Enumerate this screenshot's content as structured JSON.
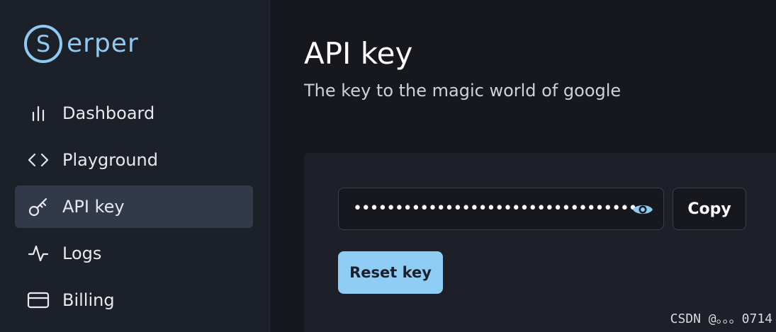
{
  "brand": {
    "logo_letter": "S",
    "logo_text": "erper",
    "color": "#8fcaf3"
  },
  "sidebar": {
    "items": [
      {
        "label": "Dashboard",
        "icon": "bar-chart-icon",
        "active": false
      },
      {
        "label": "Playground",
        "icon": "code-icon",
        "active": false
      },
      {
        "label": "API key",
        "icon": "key-icon",
        "active": true
      },
      {
        "label": "Logs",
        "icon": "activity-icon",
        "active": false
      },
      {
        "label": "Billing",
        "icon": "credit-card-icon",
        "active": false
      }
    ]
  },
  "main": {
    "title": "API key",
    "subtitle": "The key to the magic world of google",
    "key_field": {
      "masked_value": "••••••••••••••••••••••••••••••••••",
      "reveal_icon": "eye-icon"
    },
    "copy_label": "Copy",
    "reset_label": "Reset key"
  },
  "watermark": "CSDN @。。。0714",
  "colors": {
    "accent": "#90cdf4",
    "active_nav": "#323a4a",
    "background": "#16181e",
    "sidebar": "#1c2029"
  }
}
